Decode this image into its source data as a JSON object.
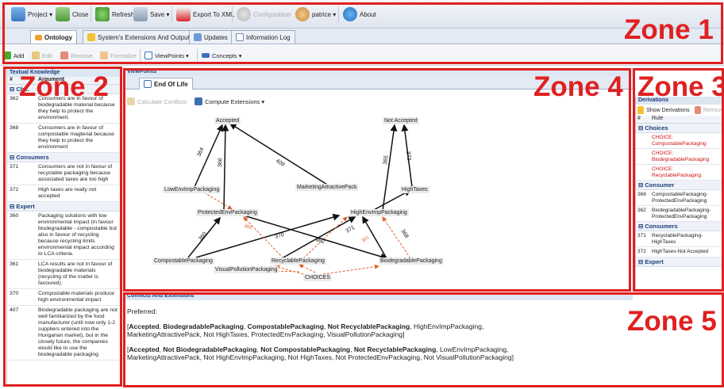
{
  "toolbar": {
    "project": "Project ▾",
    "close": "Close",
    "refresh": "Refresh",
    "save": "Save ▾",
    "export": "Export To XML",
    "configuration": "Configuration",
    "user": "patrice ▾",
    "about": "About"
  },
  "tabs": [
    "Ontology",
    "System's Extensions And Output",
    "Updates",
    "Information Log"
  ],
  "toolbar2": {
    "add": "Add",
    "edit": "Edit",
    "remove": "Remove",
    "formalize": "Formalize",
    "viewpoints": "ViewPoints ▾",
    "concepts": "Concepts ▾"
  },
  "zones": [
    "Zone 1",
    "Zone 2",
    "Zone 3",
    "Zone 4",
    "Zone 5"
  ],
  "knowledge": {
    "title": "Textual Knowledge",
    "col_num": "#",
    "col_arg": "Argument",
    "groups": [
      {
        "name": "Ch...",
        "rows": [
          {
            "id": "362",
            "text": "Consumers are in favour of biodegradable material because they help to protect the environment."
          },
          {
            "id": "368",
            "text": "Consumers are in favour of compostable magterial because they help to protect the environment"
          }
        ]
      },
      {
        "name": "Consumers",
        "rows": [
          {
            "id": "371",
            "text": "Consumers are not in favour of recyclable packaging because associated taxes are too high"
          },
          {
            "id": "372",
            "text": "High taxes are really not accepted"
          }
        ]
      },
      {
        "name": "Expert",
        "rows": [
          {
            "id": "360",
            "text": "Packaging solutions with low environmental impact (in favour biodegradable - compostable but also in favour of recycling because recycling limits environmental impact according to LCA criteria."
          },
          {
            "id": "361",
            "text": "LCA results are not in favour of biodegradable materials (recycling of the matter is favoured)."
          },
          {
            "id": "370",
            "text": "Compostable materials produce high environmental impact"
          },
          {
            "id": "407",
            "text": "Biodegradable packaging are not well familiarized by the food manufacturer (until now only 1-2 suppliers entered into the Hungarian market), but in the closely future, the companies would like to use the biodegradable packaging"
          }
        ]
      }
    ]
  },
  "viewpoints": {
    "title": "ViewPoints",
    "tab": "End Of Life",
    "calc": "Calculate Conflicts",
    "compute": "Compute Extensions ▾"
  },
  "graph": {
    "nodes": {
      "accepted": "Accepted",
      "not_accepted": "Not Accepted",
      "lowenv": "LowEnvImpPackaging",
      "marketing": "MarketingAttractivePack",
      "hightaxes": "HighTaxes",
      "protected": "ProtectedEnvPackaging",
      "highenv": "HighEnvImpPackaging",
      "compostable": "CompostablePackaging",
      "recyclable": "RecyclablePackaging",
      "biodegradable": "BiodegradablePackaging",
      "visual": "VisualPollutionPackaging",
      "choices": "CHOICES"
    },
    "edge_labels": {
      "e364": "364",
      "e366": "366",
      "e409": "409",
      "e365": "365",
      "e372": "372",
      "e360": "360",
      "e370": "370",
      "e371": "371",
      "e362": "362",
      "e369": "369",
      "e361": "361",
      "e368": "368"
    }
  },
  "derivations": {
    "title": "Derivations",
    "show": "Show Derivations",
    "remove": "Remove",
    "col_num": "#",
    "col_rule": "Rule",
    "groups": [
      {
        "name": "Choices",
        "rows": [
          {
            "id": "",
            "text": "CHOICE: CompostablePackaging",
            "red": true
          },
          {
            "id": "",
            "text": "CHOICE: BiodegradablePackaging",
            "red": true
          },
          {
            "id": "",
            "text": "CHOICE: RecyclablePackaging",
            "red": true
          }
        ]
      },
      {
        "name": "Consumer",
        "rows": [
          {
            "id": "368",
            "text": "CompostablePackaging-ProtectedEnvPackaging",
            "red": false
          },
          {
            "id": "362",
            "text": "BiodegradablePackaging-ProtectedEnvPackaging",
            "red": false
          }
        ]
      },
      {
        "name": "Consumers",
        "rows": [
          {
            "id": "371",
            "text": "RecyclablePackaging-HighTaxes",
            "red": false
          },
          {
            "id": "372",
            "text": "HighTaxes-Not Accepted",
            "red": false
          }
        ]
      },
      {
        "name": "Expert",
        "rows": []
      }
    ]
  },
  "conflicts": {
    "title": "Conflicts And Extensions",
    "preferred": "Preferred:",
    "ext1": [
      {
        "t": "[",
        "b": false
      },
      {
        "t": "Accepted",
        "b": true
      },
      {
        "t": ", ",
        "b": false
      },
      {
        "t": "BiodegradablePackaging",
        "b": true
      },
      {
        "t": ", ",
        "b": false
      },
      {
        "t": "CompostablePackaging",
        "b": true
      },
      {
        "t": ", ",
        "b": false
      },
      {
        "t": "Not RecyclablePackaging",
        "b": true
      },
      {
        "t": ", HighEnvImpPackaging, MarketingAttractivePack, Not HighTaxes, ProtectedEnvPackaging, VisualPollutionPackaging]",
        "b": false
      }
    ],
    "ext2": [
      {
        "t": "[",
        "b": false
      },
      {
        "t": "Accepted",
        "b": true
      },
      {
        "t": ", ",
        "b": false
      },
      {
        "t": "Not BiodegradablePackaging",
        "b": true
      },
      {
        "t": ", ",
        "b": false
      },
      {
        "t": "Not CompostablePackaging",
        "b": true
      },
      {
        "t": ", ",
        "b": false
      },
      {
        "t": "Not RecyclablePackaging",
        "b": true
      },
      {
        "t": ", LowEnvImpPackaging, MarketingAttractivePack, Not HighEnvImpPackaging, Not HighTaxes, Not ProtectedEnvPackaging, Not VisualPollutionPackaging]",
        "b": false
      }
    ]
  }
}
